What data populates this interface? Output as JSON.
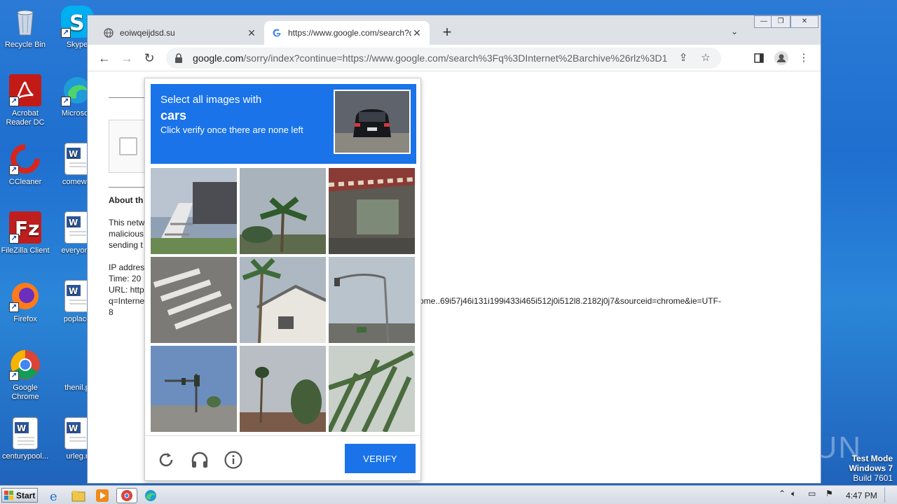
{
  "desktop": {
    "icons": [
      {
        "label": "Recycle Bin"
      },
      {
        "label": "Skype"
      },
      {
        "label": "Acrobat Reader DC"
      },
      {
        "label": "Microsoft"
      },
      {
        "label": "CCleaner"
      },
      {
        "label": "comewill"
      },
      {
        "label": "FileZilla Client"
      },
      {
        "label": "everyone"
      },
      {
        "label": "Firefox"
      },
      {
        "label": "poplace"
      },
      {
        "label": "Google Chrome"
      },
      {
        "label": "thenil.p"
      },
      {
        "label": "centurypool..."
      },
      {
        "label": "urleg.r"
      }
    ],
    "watermark": "ANY RUN",
    "testmode": {
      "line1": "Test Mode",
      "line2": "Windows 7",
      "line3": "Build 7601"
    }
  },
  "browser": {
    "tabs": [
      {
        "title": "eoiwqeijdsd.su",
        "icon": "globe-icon"
      },
      {
        "title": "https://www.google.com/search?q=",
        "icon": "google-g-icon"
      }
    ],
    "new_tab_label": "+",
    "tab_search_label": "⌄",
    "window_controls": {
      "minimize": "—",
      "restore": "❐",
      "close": "✕"
    },
    "omnibox": {
      "host": "google.com",
      "path": "/sorry/index?continue=https://www.google.com/search%3Fq%3DInternet%2Barchive%26rlz%3D1C1..."
    }
  },
  "page": {
    "about_heading": "About th",
    "para_lines": [
      "This netw",
      "malicious",
      "sending t"
    ],
    "ip_line": "IP addres",
    "time_line": "Time: 20",
    "url_line": "URL: http",
    "q_line": "q=Interne",
    "url_tail": "ome..69i57j46i131i199i433i465i512j0i512l8.2182j0j7&sourceid=chrome&ie=UTF-",
    "eight": "8"
  },
  "captcha": {
    "line1": "Select all images with",
    "target": "cars",
    "line3": "Click verify once there are none left",
    "verify_label": "VERIFY",
    "accent": "#1a73e8",
    "tiles": [
      "porch-stairs",
      "palm-trees",
      "storefront-awning",
      "crosswalk",
      "house-with-palm",
      "street-lights",
      "traffic-light-intersection",
      "trees-skyline",
      "palm-fronds"
    ]
  },
  "taskbar": {
    "start_label": "Start",
    "clock": "4:47 PM"
  }
}
